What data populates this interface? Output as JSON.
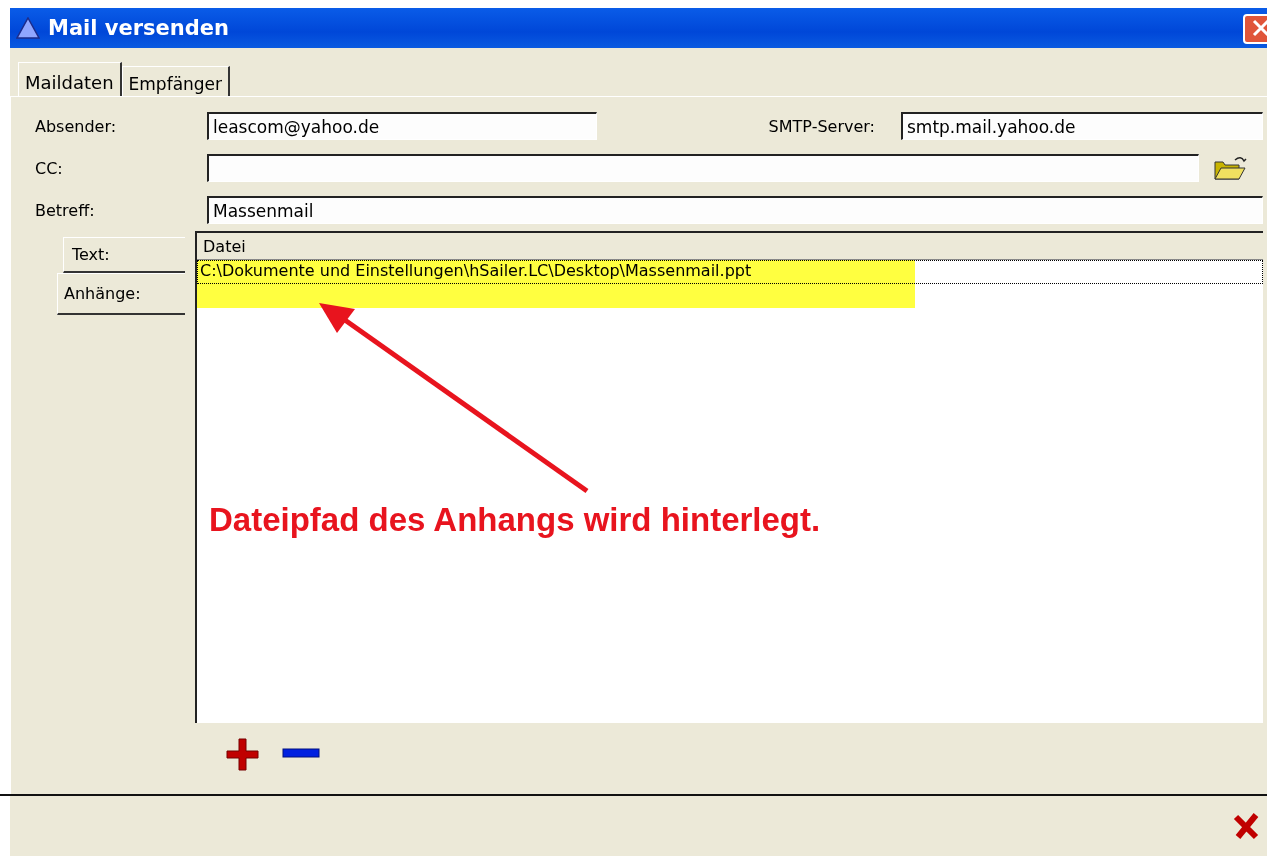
{
  "window": {
    "title": "Mail versenden"
  },
  "tabs": [
    {
      "label": "Maildaten",
      "selected": true
    },
    {
      "label": "Empfänger",
      "selected": false
    }
  ],
  "sender": {
    "label": "Absender:",
    "value": "leascom@yahoo.de"
  },
  "smtp": {
    "label": "SMTP-Server:",
    "value": "smtp.mail.yahoo.de"
  },
  "cc": {
    "label": "CC:"
  },
  "subject": {
    "label": "Betreff:",
    "value": "Massenmail"
  },
  "side_tabs": [
    {
      "label": "Text:",
      "selected": false
    },
    {
      "label": "Anhänge:",
      "selected": true
    }
  ],
  "attachments": {
    "column": "Datei",
    "rows": [
      {
        "path": "C:\\Dokumente und Einstellungen\\hSailer.LC\\Desktop\\Massenmail.ppt",
        "selected": true
      }
    ]
  },
  "annotation": {
    "text": "Dateipfad des Anhangs wird hinterlegt."
  }
}
